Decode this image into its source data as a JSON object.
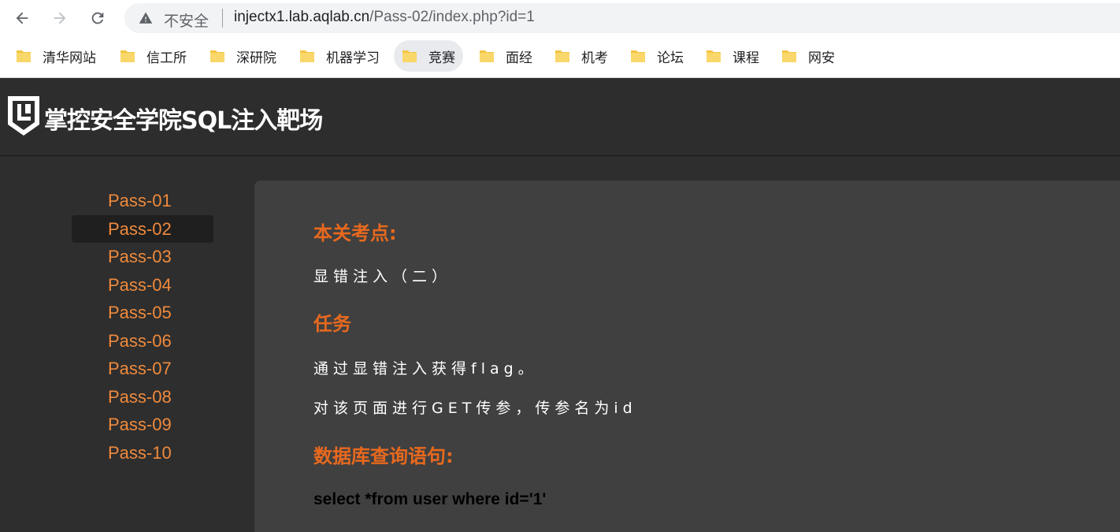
{
  "browser": {
    "insecure_label": "不安全",
    "url_host": "injectx1.lab.aqlab.cn",
    "url_path": "/Pass-02/index.php?id=1"
  },
  "bookmarks": [
    {
      "label": "清华网站"
    },
    {
      "label": "信工所"
    },
    {
      "label": "深研院"
    },
    {
      "label": "机器学习"
    },
    {
      "label": "竞赛"
    },
    {
      "label": "面经"
    },
    {
      "label": "机考"
    },
    {
      "label": "论坛"
    },
    {
      "label": "课程"
    },
    {
      "label": "网安"
    }
  ],
  "site": {
    "title": "掌控安全学院SQL注入靶场"
  },
  "sidebar": {
    "items": [
      {
        "label": "Pass-01"
      },
      {
        "label": "Pass-02"
      },
      {
        "label": "Pass-03"
      },
      {
        "label": "Pass-04"
      },
      {
        "label": "Pass-05"
      },
      {
        "label": "Pass-06"
      },
      {
        "label": "Pass-07"
      },
      {
        "label": "Pass-08"
      },
      {
        "label": "Pass-09"
      },
      {
        "label": "Pass-10"
      }
    ],
    "active": "Pass-02"
  },
  "content": {
    "heading_point": "本关考点:",
    "point_text": "显错注入（二）",
    "heading_task": "任务",
    "task_line1": "通过显错注入获得flag。",
    "task_line2": "对该页面进行GET传参，传参名为id",
    "heading_sql": "数据库查询语句:",
    "sql_text": "select *from user where id='1'"
  },
  "colors": {
    "accent": "#e8691e",
    "sidebar_link": "#f08a3c",
    "page_bg": "#2e2e2e",
    "content_bg": "#404040"
  }
}
